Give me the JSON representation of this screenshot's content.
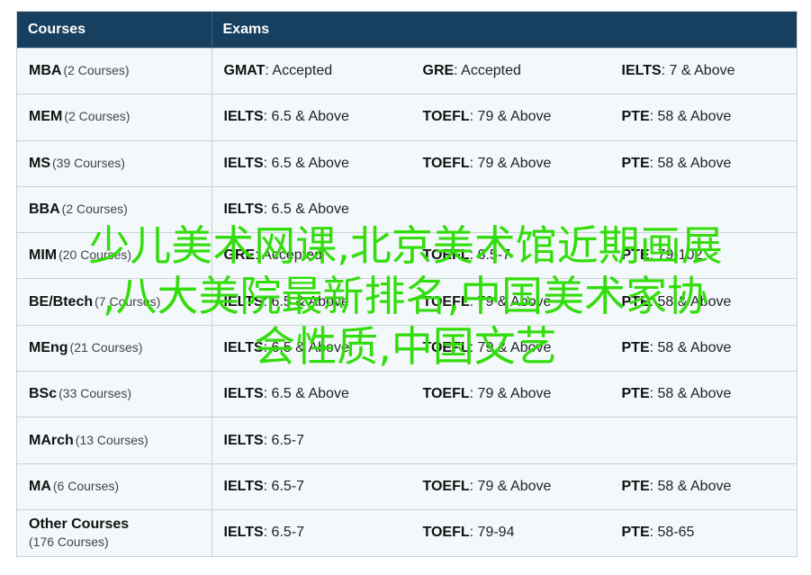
{
  "headers": {
    "courses": "Courses",
    "exams": "Exams"
  },
  "rows": [
    {
      "name": "MBA",
      "count": "(2 Courses)",
      "exams": [
        {
          "name": "GMAT",
          "value": ": Accepted"
        },
        {
          "name": "GRE",
          "value": ": Accepted"
        },
        {
          "name": "IELTS",
          "value": ": 7 & Above"
        }
      ]
    },
    {
      "name": "MEM",
      "count": "(2 Courses)",
      "exams": [
        {
          "name": "IELTS",
          "value": ": 6.5 & Above"
        },
        {
          "name": "TOEFL",
          "value": ": 79 & Above"
        },
        {
          "name": "PTE",
          "value": ": 58 & Above"
        }
      ]
    },
    {
      "name": "MS",
      "count": "(39 Courses)",
      "exams": [
        {
          "name": "IELTS",
          "value": ": 6.5 & Above"
        },
        {
          "name": "TOEFL",
          "value": ": 79 & Above"
        },
        {
          "name": "PTE",
          "value": ": 58 & Above"
        }
      ]
    },
    {
      "name": "BBA",
      "count": "(2 Courses)",
      "exams": [
        {
          "name": "IELTS",
          "value": ": 6.5 & Above"
        }
      ]
    },
    {
      "name": "MIM",
      "count": "(20 Courses)",
      "exams": [
        {
          "name": "GRE",
          "value": ": Accepted"
        },
        {
          "name": "TOEFL",
          "value": ": 6.5-7"
        },
        {
          "name": "PTE",
          "value": ": 79-102"
        }
      ]
    },
    {
      "name": "BE/Btech",
      "count": "(7 Courses)",
      "exams": [
        {
          "name": "IELTS",
          "value": ": 6.5 & Above"
        },
        {
          "name": "TOEFL",
          "value": ": 79 & Above"
        },
        {
          "name": "PTE",
          "value": ": 58 & Above"
        }
      ]
    },
    {
      "name": "MEng",
      "count": "(21 Courses)",
      "exams": [
        {
          "name": "IELTS",
          "value": ": 6.5 & Above"
        },
        {
          "name": "TOEFL",
          "value": ": 79 & Above"
        },
        {
          "name": "PTE",
          "value": ": 58 & Above"
        }
      ]
    },
    {
      "name": "BSc",
      "count": "(33 Courses)",
      "exams": [
        {
          "name": "IELTS",
          "value": ": 6.5 & Above"
        },
        {
          "name": "TOEFL",
          "value": ": 79 & Above"
        },
        {
          "name": "PTE",
          "value": ": 58 & Above"
        }
      ]
    },
    {
      "name": "MArch",
      "count": "(13 Courses)",
      "exams": [
        {
          "name": "IELTS",
          "value": ": 6.5-7"
        }
      ]
    },
    {
      "name": "MA",
      "count": "(6 Courses)",
      "exams": [
        {
          "name": "IELTS",
          "value": ": 6.5-7"
        },
        {
          "name": "TOEFL",
          "value": ": 79 & Above"
        },
        {
          "name": "PTE",
          "value": ": 58 & Above"
        }
      ]
    },
    {
      "name": "Other Courses",
      "count": "(176 Courses)",
      "exams": [
        {
          "name": "IELTS",
          "value": ": 6.5-7"
        },
        {
          "name": "TOEFL",
          "value": ": 79-94"
        },
        {
          "name": "PTE",
          "value": ": 58-65"
        }
      ]
    }
  ],
  "overlay": {
    "line1": "少儿美术网课,北京美术馆近期画展",
    "line2": ",八大美院最新排名,中国美术家协",
    "line3": "会性质,中国文艺"
  },
  "colors": {
    "header_bg": "#173f5f",
    "row_bg": "#f3f8fb",
    "border": "#c9d2d8",
    "overlay_text": "#33dd0c"
  }
}
